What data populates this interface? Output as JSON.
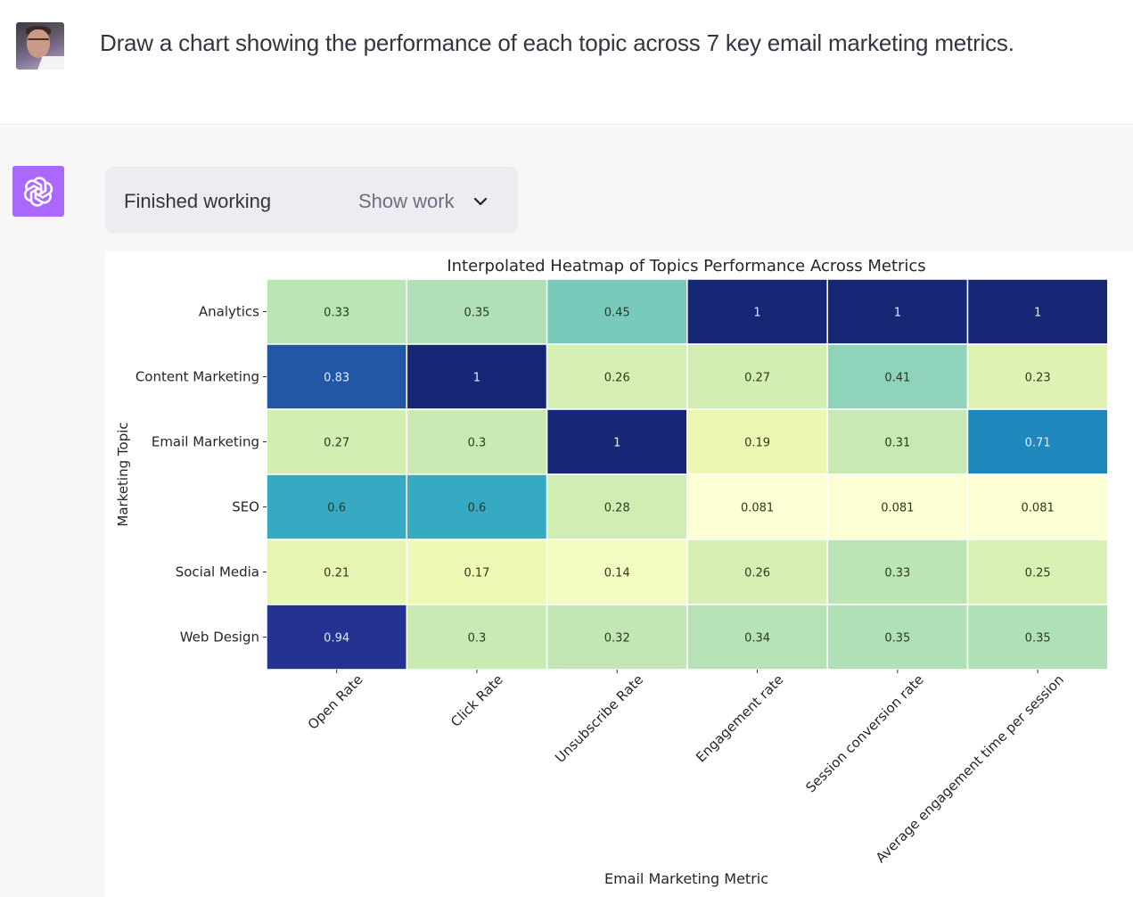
{
  "conversation": {
    "user_message": "Draw a chart showing the performance of each topic across 7 key email marketing metrics.",
    "user_avatar": "user-photo-avatar",
    "assistant_avatar": "openai-logo-icon",
    "status": {
      "label": "Finished working",
      "toggle_label": "Show work",
      "toggle_icon": "chevron-down-icon"
    }
  },
  "chart_data": {
    "type": "heatmap",
    "title": "Interpolated Heatmap of Topics Performance Across Metrics",
    "xlabel": "Email Marketing Metric",
    "ylabel": "Marketing Topic",
    "colormap": "YlGnBu",
    "value_range": [
      0.081,
      1
    ],
    "annotated": true,
    "x": [
      "Open Rate",
      "Click Rate",
      "Unsubscribe Rate",
      "Engagement rate",
      "Session conversion rate",
      "Average engagement time per session"
    ],
    "y": [
      "Analytics",
      "Content Marketing",
      "Email Marketing",
      "SEO",
      "Social Media",
      "Web Design"
    ],
    "values": [
      [
        0.33,
        0.35,
        0.45,
        1,
        1,
        1
      ],
      [
        0.83,
        1,
        0.26,
        0.27,
        0.41,
        0.23
      ],
      [
        0.27,
        0.3,
        1,
        0.19,
        0.31,
        0.71
      ],
      [
        0.6,
        0.6,
        0.28,
        0.081,
        0.081,
        0.081
      ],
      [
        0.21,
        0.17,
        0.14,
        0.26,
        0.33,
        0.25
      ],
      [
        0.94,
        0.3,
        0.32,
        0.34,
        0.35,
        0.35
      ]
    ],
    "labels": [
      [
        "0.33",
        "0.35",
        "0.45",
        "1",
        "1",
        "1"
      ],
      [
        "0.83",
        "1",
        "0.26",
        "0.27",
        "0.41",
        "0.23"
      ],
      [
        "0.27",
        "0.3",
        "1",
        "0.19",
        "0.31",
        "0.71"
      ],
      [
        "0.6",
        "0.6",
        "0.28",
        "0.081",
        "0.081",
        "0.081"
      ],
      [
        "0.21",
        "0.17",
        "0.14",
        "0.26",
        "0.33",
        "0.25"
      ],
      [
        "0.94",
        "0.3",
        "0.32",
        "0.34",
        "0.35",
        "0.35"
      ]
    ]
  }
}
